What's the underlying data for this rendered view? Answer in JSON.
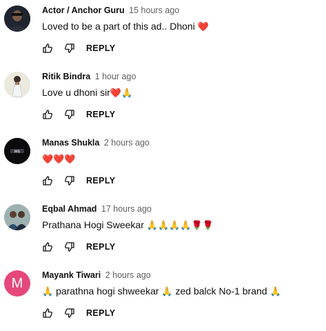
{
  "comments": [
    {
      "author": "Actor / Anchor Guru",
      "time": "15 hours ago",
      "text": "Loved to be a part of this ad.. Dhoni",
      "emoji": "❤️",
      "reply_label": "REPLY",
      "avatar": {
        "kind": "photo",
        "bg": "#1b1f28"
      }
    },
    {
      "author": "Ritik Bindra",
      "time": "1 hour ago",
      "text": "Love u dhoni sir",
      "emoji": "❤️🙏",
      "reply_label": "REPLY",
      "avatar": {
        "kind": "photo",
        "bg": "#e9e6dc"
      }
    },
    {
      "author": "Manas Shukla",
      "time": "2 hours ago",
      "text": "",
      "emoji": "❤️❤️❤️",
      "reply_label": "REPLY",
      "avatar": {
        "kind": "photo",
        "bg": "#0d0d0f"
      }
    },
    {
      "author": "Eqbal Ahmad",
      "time": "17 hours ago",
      "text": "Prathana Hogi Sweekar",
      "emoji": "🙏🙏🙏🙏🌹🌹",
      "reply_label": "REPLY",
      "avatar": {
        "kind": "photo",
        "bg": "#8fa6a8"
      }
    },
    {
      "author": "Mayank Tiwari",
      "time": "2 hours ago",
      "text_parts": [
        "🙏",
        " parathna hogi shweekar ",
        "🙏",
        " zed balck No-1 brand ",
        "🙏"
      ],
      "reply_label": "REPLY",
      "avatar": {
        "kind": "letter",
        "letter": "M",
        "bg": "#e5487a"
      }
    }
  ],
  "icons": {
    "like": "thumbs-up-icon",
    "dislike": "thumbs-down-icon"
  },
  "colors": {
    "text": "#0f0f0f",
    "meta": "#606060",
    "avatar_m": "#e5487a",
    "heart": "#e0364f"
  }
}
